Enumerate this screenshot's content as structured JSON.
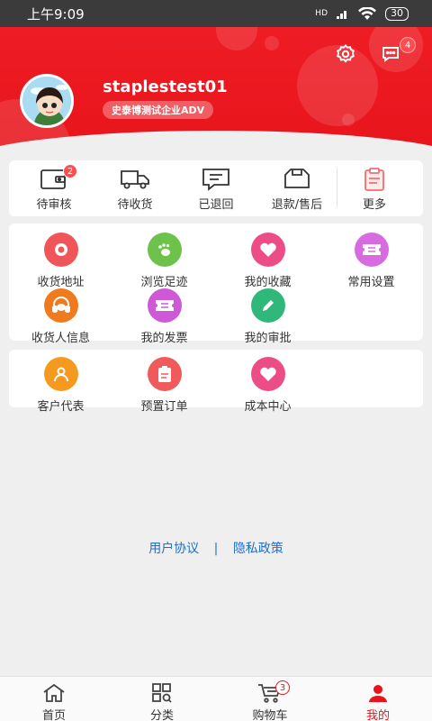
{
  "status_bar": {
    "time": "上午9:09",
    "network": "HD",
    "battery": "30"
  },
  "header": {
    "username": "staplestest01",
    "company": "史泰博测试企业ADV",
    "message_badge": "4"
  },
  "orders": [
    {
      "label": "待审核",
      "badge": "2"
    },
    {
      "label": "待收货"
    },
    {
      "label": "已退回"
    },
    {
      "label": "退款/售后"
    },
    {
      "label": "更多"
    }
  ],
  "services": [
    {
      "label": "收货地址",
      "color": "#f0555a"
    },
    {
      "label": "浏览足迹",
      "color": "#6cc24a"
    },
    {
      "label": "我的收藏",
      "color": "#ec4d86"
    },
    {
      "label": "常用设置",
      "color": "#d96be0"
    },
    {
      "label": "收货人信息",
      "color": "#f07a1e"
    },
    {
      "label": "我的发票",
      "color": "#cf58d6"
    },
    {
      "label": "我的审批",
      "color": "#2fb879"
    }
  ],
  "extras": [
    {
      "label": "客户代表",
      "color": "#f59a1e"
    },
    {
      "label": "预置订单",
      "color": "#f05a5a"
    },
    {
      "label": "成本中心",
      "color": "#ec4d86"
    }
  ],
  "footer": {
    "agreement": "用户协议",
    "separator": "|",
    "privacy": "隐私政策"
  },
  "tabbar": {
    "home": "首页",
    "category": "分类",
    "cart": "购物车",
    "cart_badge": "3",
    "mine": "我的"
  },
  "colors": {
    "brand_red": "#e8141c",
    "link_blue": "#1f6fd1"
  }
}
